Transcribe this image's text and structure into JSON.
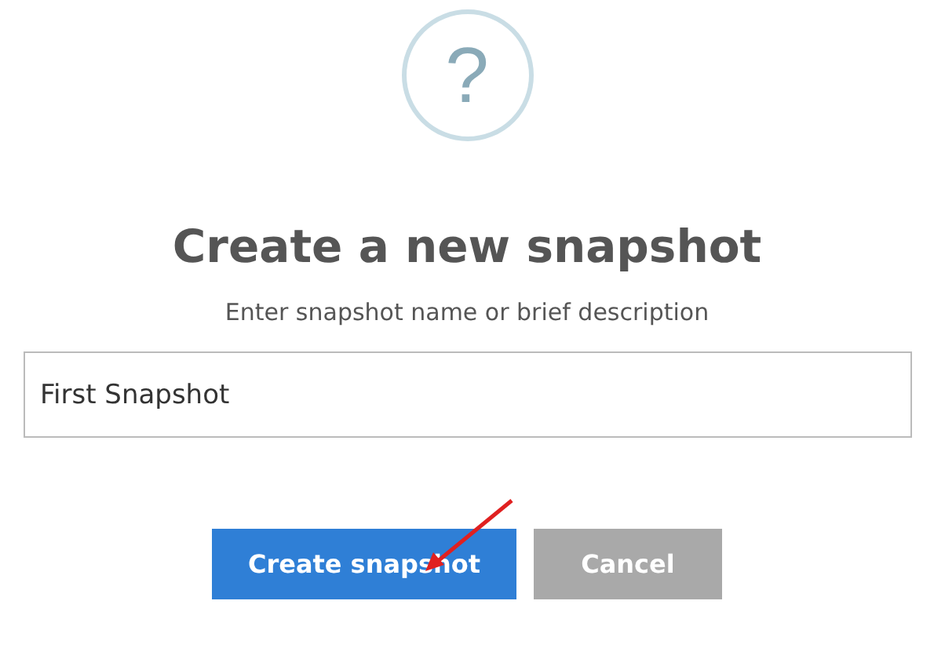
{
  "icon": {
    "symbol": "?"
  },
  "title": "Create a new snapshot",
  "subtitle": "Enter snapshot name or brief description",
  "name_field": {
    "value": "First Snapshot"
  },
  "buttons": [
    {
      "label": "Create snapshot",
      "kind": "primary"
    },
    {
      "label": "Cancel",
      "kind": "secondary"
    }
  ]
}
